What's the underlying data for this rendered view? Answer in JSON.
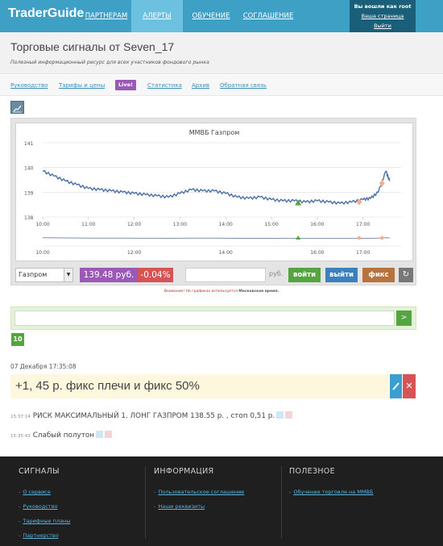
{
  "header": {
    "logo": "TraderGuide",
    "nav": [
      {
        "label": "ПАРТНЕРАМ"
      },
      {
        "label": "АЛЕРТЫ"
      },
      {
        "label": "ОБУЧЕНИЕ"
      },
      {
        "label": "СОГЛАШЕНИЕ"
      }
    ],
    "active_nav": "АЛЕРТЫ",
    "user": {
      "line1": "Вы вошли как root",
      "line2": "Ваша страница",
      "line3": "Выйти"
    }
  },
  "page": {
    "title": "Торговые сигналы от Seven_17",
    "subtitle": "Полезный информационный ресурс для всех участников фондового рынка"
  },
  "subnav": {
    "items": [
      "Руководство",
      "Тарифы и цены",
      "Статистика",
      "Архив",
      "Обратная связь"
    ],
    "live_badge": "Live!"
  },
  "chart": {
    "title": "ММВБ Газпром",
    "y_ticks": [
      "141",
      "140",
      "139",
      "138"
    ],
    "x_ticks": [
      "10:00",
      "11:00",
      "12:00",
      "13:00",
      "14:00",
      "15:00",
      "16:00",
      "17:00"
    ],
    "nav_x_ticks": [
      "10:00",
      "12:00",
      "14:00",
      "16:00",
      "17:00"
    ],
    "line_color": "#4a6fa5"
  },
  "chart_data": {
    "type": "line",
    "title": "ММВБ Газпром",
    "xlabel": "",
    "ylabel": "",
    "ylim": [
      138,
      141
    ],
    "x": [
      "10:00",
      "10:15",
      "10:30",
      "10:45",
      "11:00",
      "11:15",
      "11:30",
      "11:45",
      "12:00",
      "12:15",
      "12:30",
      "12:45",
      "13:00",
      "13:15",
      "13:30",
      "13:45",
      "14:00",
      "14:15",
      "14:30",
      "14:45",
      "15:00",
      "15:15",
      "15:30",
      "15:45",
      "16:00",
      "16:15",
      "16:30",
      "16:45",
      "17:00",
      "17:10",
      "17:20",
      "17:30",
      "17:35"
    ],
    "series": [
      {
        "values": [
          139.85,
          139.65,
          139.45,
          139.3,
          139.15,
          139.1,
          139.05,
          139.0,
          138.95,
          138.9,
          138.85,
          138.8,
          138.95,
          139.1,
          139.05,
          139.05,
          138.95,
          138.8,
          138.75,
          138.8,
          138.7,
          138.65,
          138.65,
          138.6,
          138.65,
          138.6,
          138.55,
          138.6,
          138.7,
          138.75,
          139.0,
          139.85,
          139.45
        ]
      }
    ],
    "markers": [
      {
        "time": "15:35",
        "kind": "enter",
        "color": "#54a43f"
      },
      {
        "time": "16:55",
        "kind": "fix",
        "color": "#f0b08a"
      },
      {
        "time": "17:25",
        "kind": "fix",
        "color": "#f0b08a"
      }
    ]
  },
  "controls": {
    "ticker": "Газпром",
    "price": "139.48 руб.",
    "change": "-0.04%",
    "price_placeholder": "",
    "rub": "руб.",
    "enter": "войти",
    "exit": "выйти",
    "fix": "фикс",
    "refresh": "↻"
  },
  "note": {
    "text": "Внимание! На графиках используется",
    "bold": "Московское время."
  },
  "message": {
    "placeholder": "",
    "send": ">",
    "count": "10"
  },
  "signals": {
    "date": "07 Декабря 17:35:08",
    "post": "+1, 45 р. фикс плечи и фикс 50%",
    "items": [
      {
        "time": "15:37:14",
        "text": "РИСК МАКСИМАЛЬНЫЙ 1. ЛОНГ ГАЗПРОМ 138.55 р. , стоп 0,51 р."
      },
      {
        "time": "15:35:43",
        "text": "Слабый полутон"
      }
    ]
  },
  "footer": {
    "columns": [
      {
        "title": "СИГНАЛЫ",
        "items": [
          "О сервисе",
          "Руководство",
          "Тарифные планы",
          "Партнерство"
        ]
      },
      {
        "title": "ИНФОРМАЦИЯ",
        "items": [
          "Пользовательское соглашение",
          "Наши реквизиты"
        ]
      },
      {
        "title": "ПОЛЕЗНОЕ",
        "items": [
          "Обучение торговле на ММВБ"
        ]
      }
    ]
  }
}
